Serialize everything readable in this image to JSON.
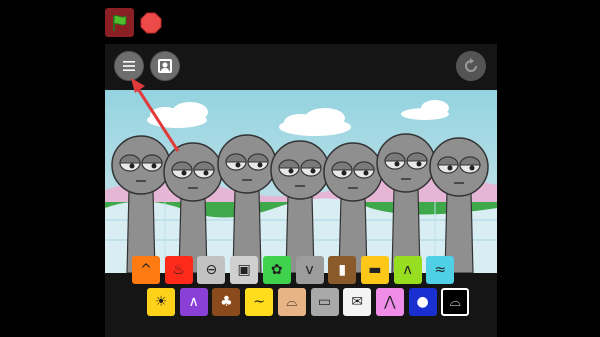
{
  "app": {
    "controls": {
      "start": "green-flag-icon",
      "stop": "stop-sign-icon"
    },
    "toolbar": {
      "menu": "hamburger-menu-icon",
      "gallery": "portrait-icon",
      "reset": "reset-icon"
    }
  },
  "scene": {
    "sky_color": "#93d3df",
    "horizon_color": "#e0a5cb",
    "ground_color": "#3fa84a",
    "character_color": "#8f8f8f",
    "character_count": 7
  },
  "palette": {
    "row1": [
      {
        "name": "orange-spiky-icon",
        "color": "#ff7b12"
      },
      {
        "name": "red-flame-icon",
        "color": "#ff2a1a"
      },
      {
        "name": "gray-drum-icon",
        "color": "#c2c2c2"
      },
      {
        "name": "robot-head-icon",
        "color": "#cfcfcf"
      },
      {
        "name": "pink-flower-icon",
        "color": "#3fd24d"
      },
      {
        "name": "gray-horns-icon",
        "color": "#9c9c9c"
      },
      {
        "name": "brown-box-icon",
        "color": "#8a5a2b"
      },
      {
        "name": "sunglasses-icon",
        "color": "#ffc818"
      },
      {
        "name": "green-spikes-icon",
        "color": "#98de20"
      },
      {
        "name": "cyan-splash-icon",
        "color": "#4fd0e6"
      }
    ],
    "row2": [
      {
        "name": "sun-icon",
        "color": "#ffd21a"
      },
      {
        "name": "purple-ears-icon",
        "color": "#8a3fd6"
      },
      {
        "name": "tree-icon",
        "color": "#8a4a1b"
      },
      {
        "name": "yellow-curls-icon",
        "color": "#ffdc1c"
      },
      {
        "name": "brown-hat-icon",
        "color": "#e6b485"
      },
      {
        "name": "computer-monitor-icon",
        "color": "#a9a9a9"
      },
      {
        "name": "envelope-icon",
        "color": "#f4f4f4"
      },
      {
        "name": "pink-bunny-icon",
        "color": "#f08de8"
      },
      {
        "name": "blue-hood-icon",
        "color": "#1a2fd0"
      },
      {
        "name": "black-hat-icon",
        "color": "#000000"
      }
    ]
  }
}
